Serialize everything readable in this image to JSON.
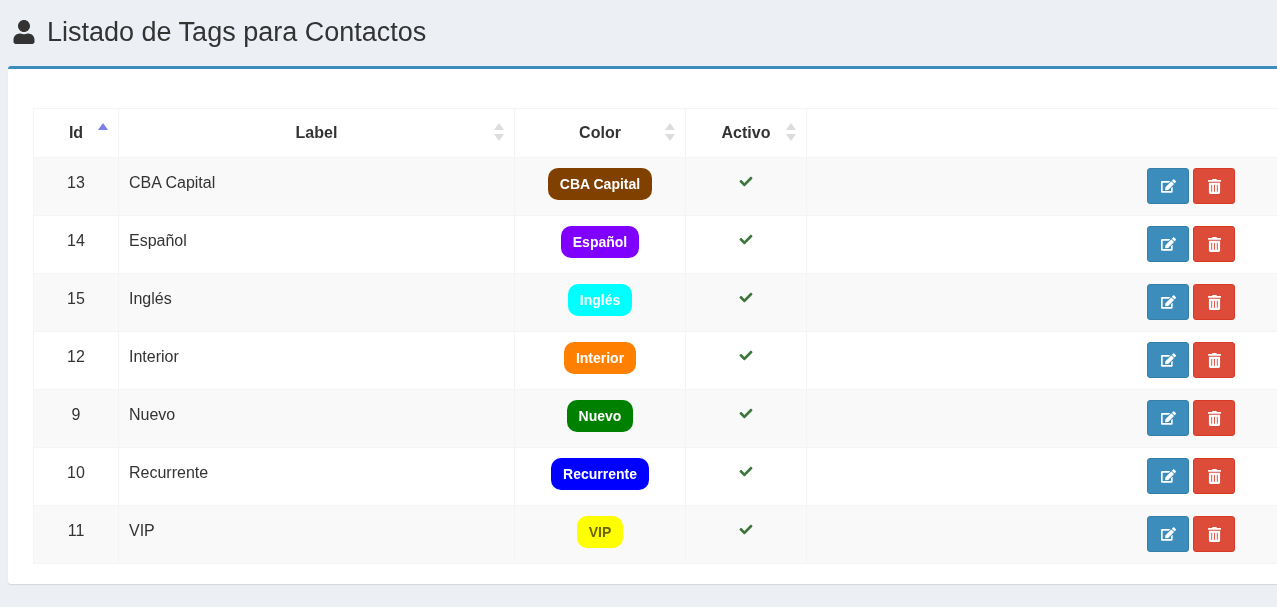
{
  "page": {
    "title": "Listado de Tags para Contactos"
  },
  "table": {
    "columns": [
      {
        "label": "Id",
        "sorted": true
      },
      {
        "label": "Label",
        "sorted": false
      },
      {
        "label": "Color",
        "sorted": false
      },
      {
        "label": "Activo",
        "sorted": false
      }
    ],
    "rows": [
      {
        "id": "13",
        "label": "CBA Capital",
        "tag": {
          "text": "CBA Capital",
          "color": "#804000"
        },
        "active": true
      },
      {
        "id": "14",
        "label": "Español",
        "tag": {
          "text": "Español",
          "color": "#8000ff"
        },
        "active": true
      },
      {
        "id": "15",
        "label": "Inglés",
        "tag": {
          "text": "Inglés",
          "color": "#00ffff"
        },
        "active": true
      },
      {
        "id": "12",
        "label": "Interior",
        "tag": {
          "text": "Interior",
          "color": "#ff8000"
        },
        "active": true
      },
      {
        "id": "9",
        "label": "Nuevo",
        "tag": {
          "text": "Nuevo",
          "color": "#008000"
        },
        "active": true
      },
      {
        "id": "10",
        "label": "Recurrente",
        "tag": {
          "text": "Recurrente",
          "color": "#0000ff"
        },
        "active": true
      },
      {
        "id": "11",
        "label": "VIP",
        "tag": {
          "text": "VIP",
          "color": "#ffff00"
        },
        "active": true
      }
    ]
  }
}
